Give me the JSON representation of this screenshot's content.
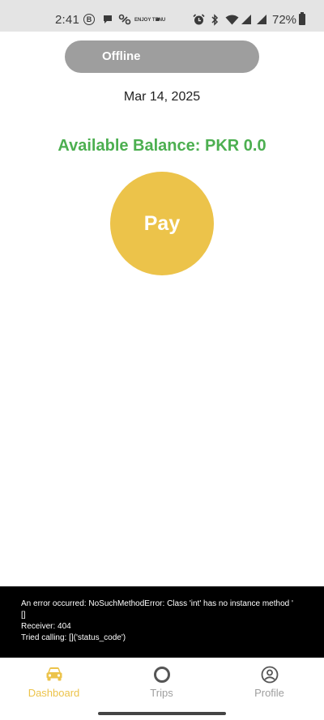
{
  "status_bar": {
    "time": "2:41",
    "battery": "72%",
    "tiny_text": "ENJOY TENU"
  },
  "status": {
    "toggle_label": "Offline"
  },
  "main": {
    "date": "Mar 14, 2025",
    "balance": "Available Balance: PKR 0.0",
    "pay_label": "Pay"
  },
  "error": {
    "line1": "An error occurred: NoSuchMethodError: Class 'int' has no instance method '",
    "line2": "[]",
    "line3": "Receiver: 404",
    "line4": "Tried calling: []('status_code')"
  },
  "nav": {
    "items": [
      {
        "label": "Dashboard",
        "icon": "car-icon",
        "active": true
      },
      {
        "label": "Trips",
        "icon": "circle-icon",
        "active": false
      },
      {
        "label": "Profile",
        "icon": "profile-icon",
        "active": false
      }
    ]
  },
  "colors": {
    "accent": "#ecc34a",
    "balance_green": "#4caf50",
    "offline_gray": "#9e9e9e",
    "status_bar": "#e4e4e4"
  }
}
